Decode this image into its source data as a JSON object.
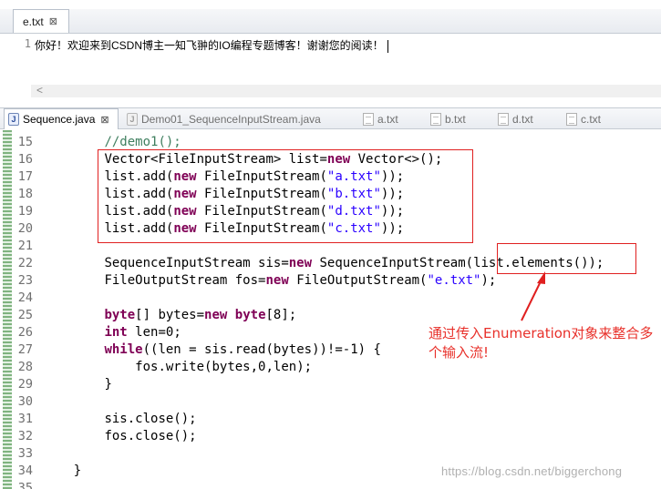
{
  "top_editor": {
    "tab_label": "e.txt",
    "line_number": "1",
    "content": "你好！欢迎来到CSDN博主一知飞翀的IO编程专题博客！谢谢您的阅读！"
  },
  "file_tabs": [
    {
      "label": "Sequence.java",
      "type": "java",
      "active": true
    },
    {
      "label": "Demo01_SequenceInputStream.java",
      "type": "java",
      "active": false
    },
    {
      "label": "a.txt",
      "type": "txt",
      "active": false
    },
    {
      "label": "b.txt",
      "type": "txt",
      "active": false
    },
    {
      "label": "d.txt",
      "type": "txt",
      "active": false
    },
    {
      "label": "c.txt",
      "type": "txt",
      "active": false
    }
  ],
  "code_lines": [
    {
      "n": "15",
      "indent": "    ",
      "tokens": [
        [
          "c",
          "//demo1();"
        ]
      ]
    },
    {
      "n": "16",
      "indent": "    ",
      "tokens": [
        [
          "p",
          "Vector<FileInputStream> "
        ],
        [
          "v",
          "list"
        ],
        [
          "p",
          "="
        ],
        [
          "k",
          "new"
        ],
        [
          "p",
          " Vector<>();"
        ]
      ]
    },
    {
      "n": "17",
      "indent": "    ",
      "tokens": [
        [
          "v",
          "list"
        ],
        [
          "p",
          ".add("
        ],
        [
          "k",
          "new"
        ],
        [
          "p",
          " FileInputStream("
        ],
        [
          "s",
          "\"a.txt\""
        ],
        [
          "p",
          "));"
        ]
      ]
    },
    {
      "n": "18",
      "indent": "    ",
      "tokens": [
        [
          "v",
          "list"
        ],
        [
          "p",
          ".add("
        ],
        [
          "k",
          "new"
        ],
        [
          "p",
          " FileInputStream("
        ],
        [
          "s",
          "\"b.txt\""
        ],
        [
          "p",
          "));"
        ]
      ]
    },
    {
      "n": "19",
      "indent": "    ",
      "tokens": [
        [
          "v",
          "list"
        ],
        [
          "p",
          ".add("
        ],
        [
          "k",
          "new"
        ],
        [
          "p",
          " FileInputStream("
        ],
        [
          "s",
          "\"d.txt\""
        ],
        [
          "p",
          "));"
        ]
      ]
    },
    {
      "n": "20",
      "indent": "    ",
      "tokens": [
        [
          "v",
          "list"
        ],
        [
          "p",
          ".add("
        ],
        [
          "k",
          "new"
        ],
        [
          "p",
          " FileInputStream("
        ],
        [
          "s",
          "\"c.txt\""
        ],
        [
          "p",
          "));"
        ]
      ]
    },
    {
      "n": "21",
      "indent": "",
      "tokens": []
    },
    {
      "n": "22",
      "indent": "    ",
      "tokens": [
        [
          "p",
          "SequenceInputStream "
        ],
        [
          "v",
          "sis"
        ],
        [
          "p",
          "="
        ],
        [
          "k",
          "new"
        ],
        [
          "p",
          " SequenceInputStream("
        ],
        [
          "v",
          "list"
        ],
        [
          "p",
          ".elements());"
        ]
      ]
    },
    {
      "n": "23",
      "indent": "    ",
      "tokens": [
        [
          "p",
          "FileOutputStream "
        ],
        [
          "v",
          "fos"
        ],
        [
          "p",
          "="
        ],
        [
          "k",
          "new"
        ],
        [
          "p",
          " FileOutputStream("
        ],
        [
          "s",
          "\"e.txt\""
        ],
        [
          "p",
          ");"
        ]
      ]
    },
    {
      "n": "24",
      "indent": "",
      "tokens": []
    },
    {
      "n": "25",
      "indent": "    ",
      "tokens": [
        [
          "k",
          "byte"
        ],
        [
          "p",
          "[] "
        ],
        [
          "v",
          "bytes"
        ],
        [
          "p",
          "="
        ],
        [
          "k",
          "new"
        ],
        [
          "p",
          " "
        ],
        [
          "k",
          "byte"
        ],
        [
          "p",
          "[8];"
        ]
      ]
    },
    {
      "n": "26",
      "indent": "    ",
      "tokens": [
        [
          "k",
          "int"
        ],
        [
          "p",
          " "
        ],
        [
          "v",
          "len"
        ],
        [
          "p",
          "=0;"
        ]
      ]
    },
    {
      "n": "27",
      "indent": "    ",
      "tokens": [
        [
          "k",
          "while"
        ],
        [
          "p",
          "(("
        ],
        [
          "v",
          "len"
        ],
        [
          "p",
          " = "
        ],
        [
          "v",
          "sis"
        ],
        [
          "p",
          ".read("
        ],
        [
          "v",
          "bytes"
        ],
        [
          "p",
          "))!=-1) {"
        ]
      ]
    },
    {
      "n": "28",
      "indent": "        ",
      "tokens": [
        [
          "v",
          "fos"
        ],
        [
          "p",
          ".write("
        ],
        [
          "v",
          "bytes"
        ],
        [
          "p",
          ",0,"
        ],
        [
          "v",
          "len"
        ],
        [
          "p",
          ");"
        ]
      ]
    },
    {
      "n": "29",
      "indent": "    ",
      "tokens": [
        [
          "p",
          "}"
        ]
      ]
    },
    {
      "n": "30",
      "indent": "",
      "tokens": []
    },
    {
      "n": "31",
      "indent": "    ",
      "tokens": [
        [
          "v",
          "sis"
        ],
        [
          "p",
          ".close();"
        ]
      ]
    },
    {
      "n": "32",
      "indent": "    ",
      "tokens": [
        [
          "v",
          "fos"
        ],
        [
          "p",
          ".close();"
        ]
      ]
    },
    {
      "n": "33",
      "indent": "",
      "tokens": []
    },
    {
      "n": "34",
      "indent": "",
      "tokens": [
        [
          "p",
          "}"
        ]
      ]
    },
    {
      "n": "35",
      "indent": "",
      "tokens": []
    }
  ],
  "annotation": {
    "text": "通过传入Enumeration对象来整合多个输入流!",
    "color": "#e8302a"
  },
  "watermark": "https://blog.csdn.net/biggerchong",
  "colors": {
    "keyword": "#7f0055",
    "string": "#2a00ff",
    "comment": "#3f7f5f",
    "variable": "#6a3e3e",
    "highlight_box": "#e02020"
  }
}
